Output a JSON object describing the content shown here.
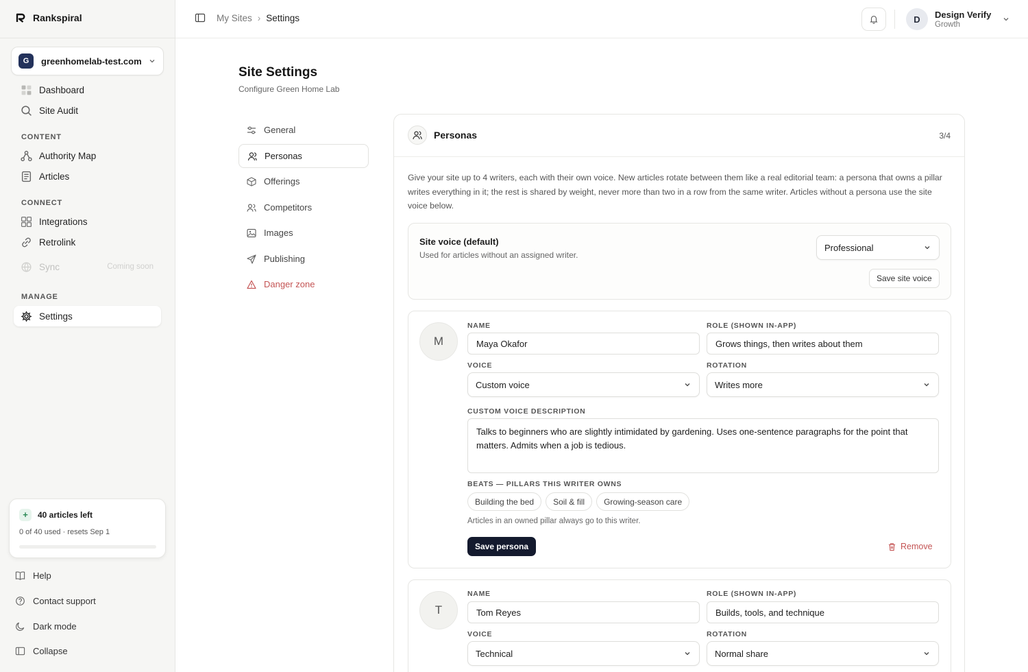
{
  "sidebar": {
    "brand": "Rankspiral",
    "site": {
      "initial": "G",
      "name": "greenhomelab-test.com"
    },
    "items_top": [
      {
        "label": "Dashboard",
        "icon": "grid-icon"
      },
      {
        "label": "Site Audit",
        "icon": "search-icon"
      }
    ],
    "section_content": "CONTENT",
    "items_content": [
      {
        "label": "Authority Map",
        "icon": "network-icon"
      },
      {
        "label": "Articles",
        "icon": "document-icon"
      }
    ],
    "section_connect": "CONNECT",
    "items_connect": [
      {
        "label": "Integrations",
        "icon": "grid-icon"
      },
      {
        "label": "Retrolink",
        "icon": "link-icon"
      },
      {
        "label": "Sync",
        "icon": "globe-icon",
        "badge": "Coming soon"
      }
    ],
    "section_manage": "MANAGE",
    "settings_label": "Settings",
    "quota": {
      "title": "40 articles left",
      "sub": "0 of 40 used · resets Sep 1",
      "used_fraction": 0
    },
    "footer": [
      {
        "label": "Help",
        "icon": "book-icon"
      },
      {
        "label": "Contact support",
        "icon": "help-circle-icon"
      },
      {
        "label": "Dark mode",
        "icon": "moon-icon"
      },
      {
        "label": "Collapse",
        "icon": "sidebar-icon"
      }
    ]
  },
  "topbar": {
    "breadcrumb": [
      "My Sites",
      "Settings"
    ],
    "user": {
      "initial": "D",
      "name": "Design Verify",
      "plan": "Growth"
    }
  },
  "page": {
    "title": "Site Settings",
    "subtitle": "Configure Green Home Lab"
  },
  "settings_nav": [
    {
      "label": "General",
      "icon": "sliders-icon"
    },
    {
      "label": "Personas",
      "icon": "user-icon"
    },
    {
      "label": "Offerings",
      "icon": "box-icon"
    },
    {
      "label": "Competitors",
      "icon": "users-icon"
    },
    {
      "label": "Images",
      "icon": "image-icon"
    },
    {
      "label": "Publishing",
      "icon": "send-icon"
    },
    {
      "label": "Danger zone",
      "icon": "warning-icon"
    }
  ],
  "personas_card": {
    "title": "Personas",
    "count": "3/4",
    "intro": "Give your site up to 4 writers, each with their own voice. New articles rotate between them like a real editorial team: a persona that owns a pillar writes everything in it; the rest is shared by weight, never more than two in a row from the same writer. Articles without a persona use the site voice below.",
    "site_voice": {
      "title": "Site voice (default)",
      "subtitle": "Used for articles without an assigned writer.",
      "value": "Professional",
      "save_label": "Save site voice"
    },
    "labels": {
      "name": "NAME",
      "role": "ROLE (SHOWN IN-APP)",
      "voice": "VOICE",
      "rotation": "ROTATION",
      "custom_voice": "CUSTOM VOICE DESCRIPTION",
      "beats": "BEATS — PILLARS THIS WRITER OWNS",
      "beats_note": "Articles in an owned pillar always go to this writer.",
      "save": "Save persona",
      "remove": "Remove"
    },
    "personas": [
      {
        "initial": "M",
        "name": "Maya Okafor",
        "role": "Grows things, then writes about them",
        "voice": "Custom voice",
        "rotation": "Writes more",
        "custom_voice": "Talks to beginners who are slightly intimidated by gardening. Uses one-sentence paragraphs for the point that matters. Admits when a job is tedious.",
        "beats": [
          "Building the bed",
          "Soil & fill",
          "Growing-season care"
        ]
      },
      {
        "initial": "T",
        "name": "Tom Reyes",
        "role": "Builds, tools, and technique",
        "voice": "Technical",
        "rotation": "Normal share"
      }
    ]
  }
}
